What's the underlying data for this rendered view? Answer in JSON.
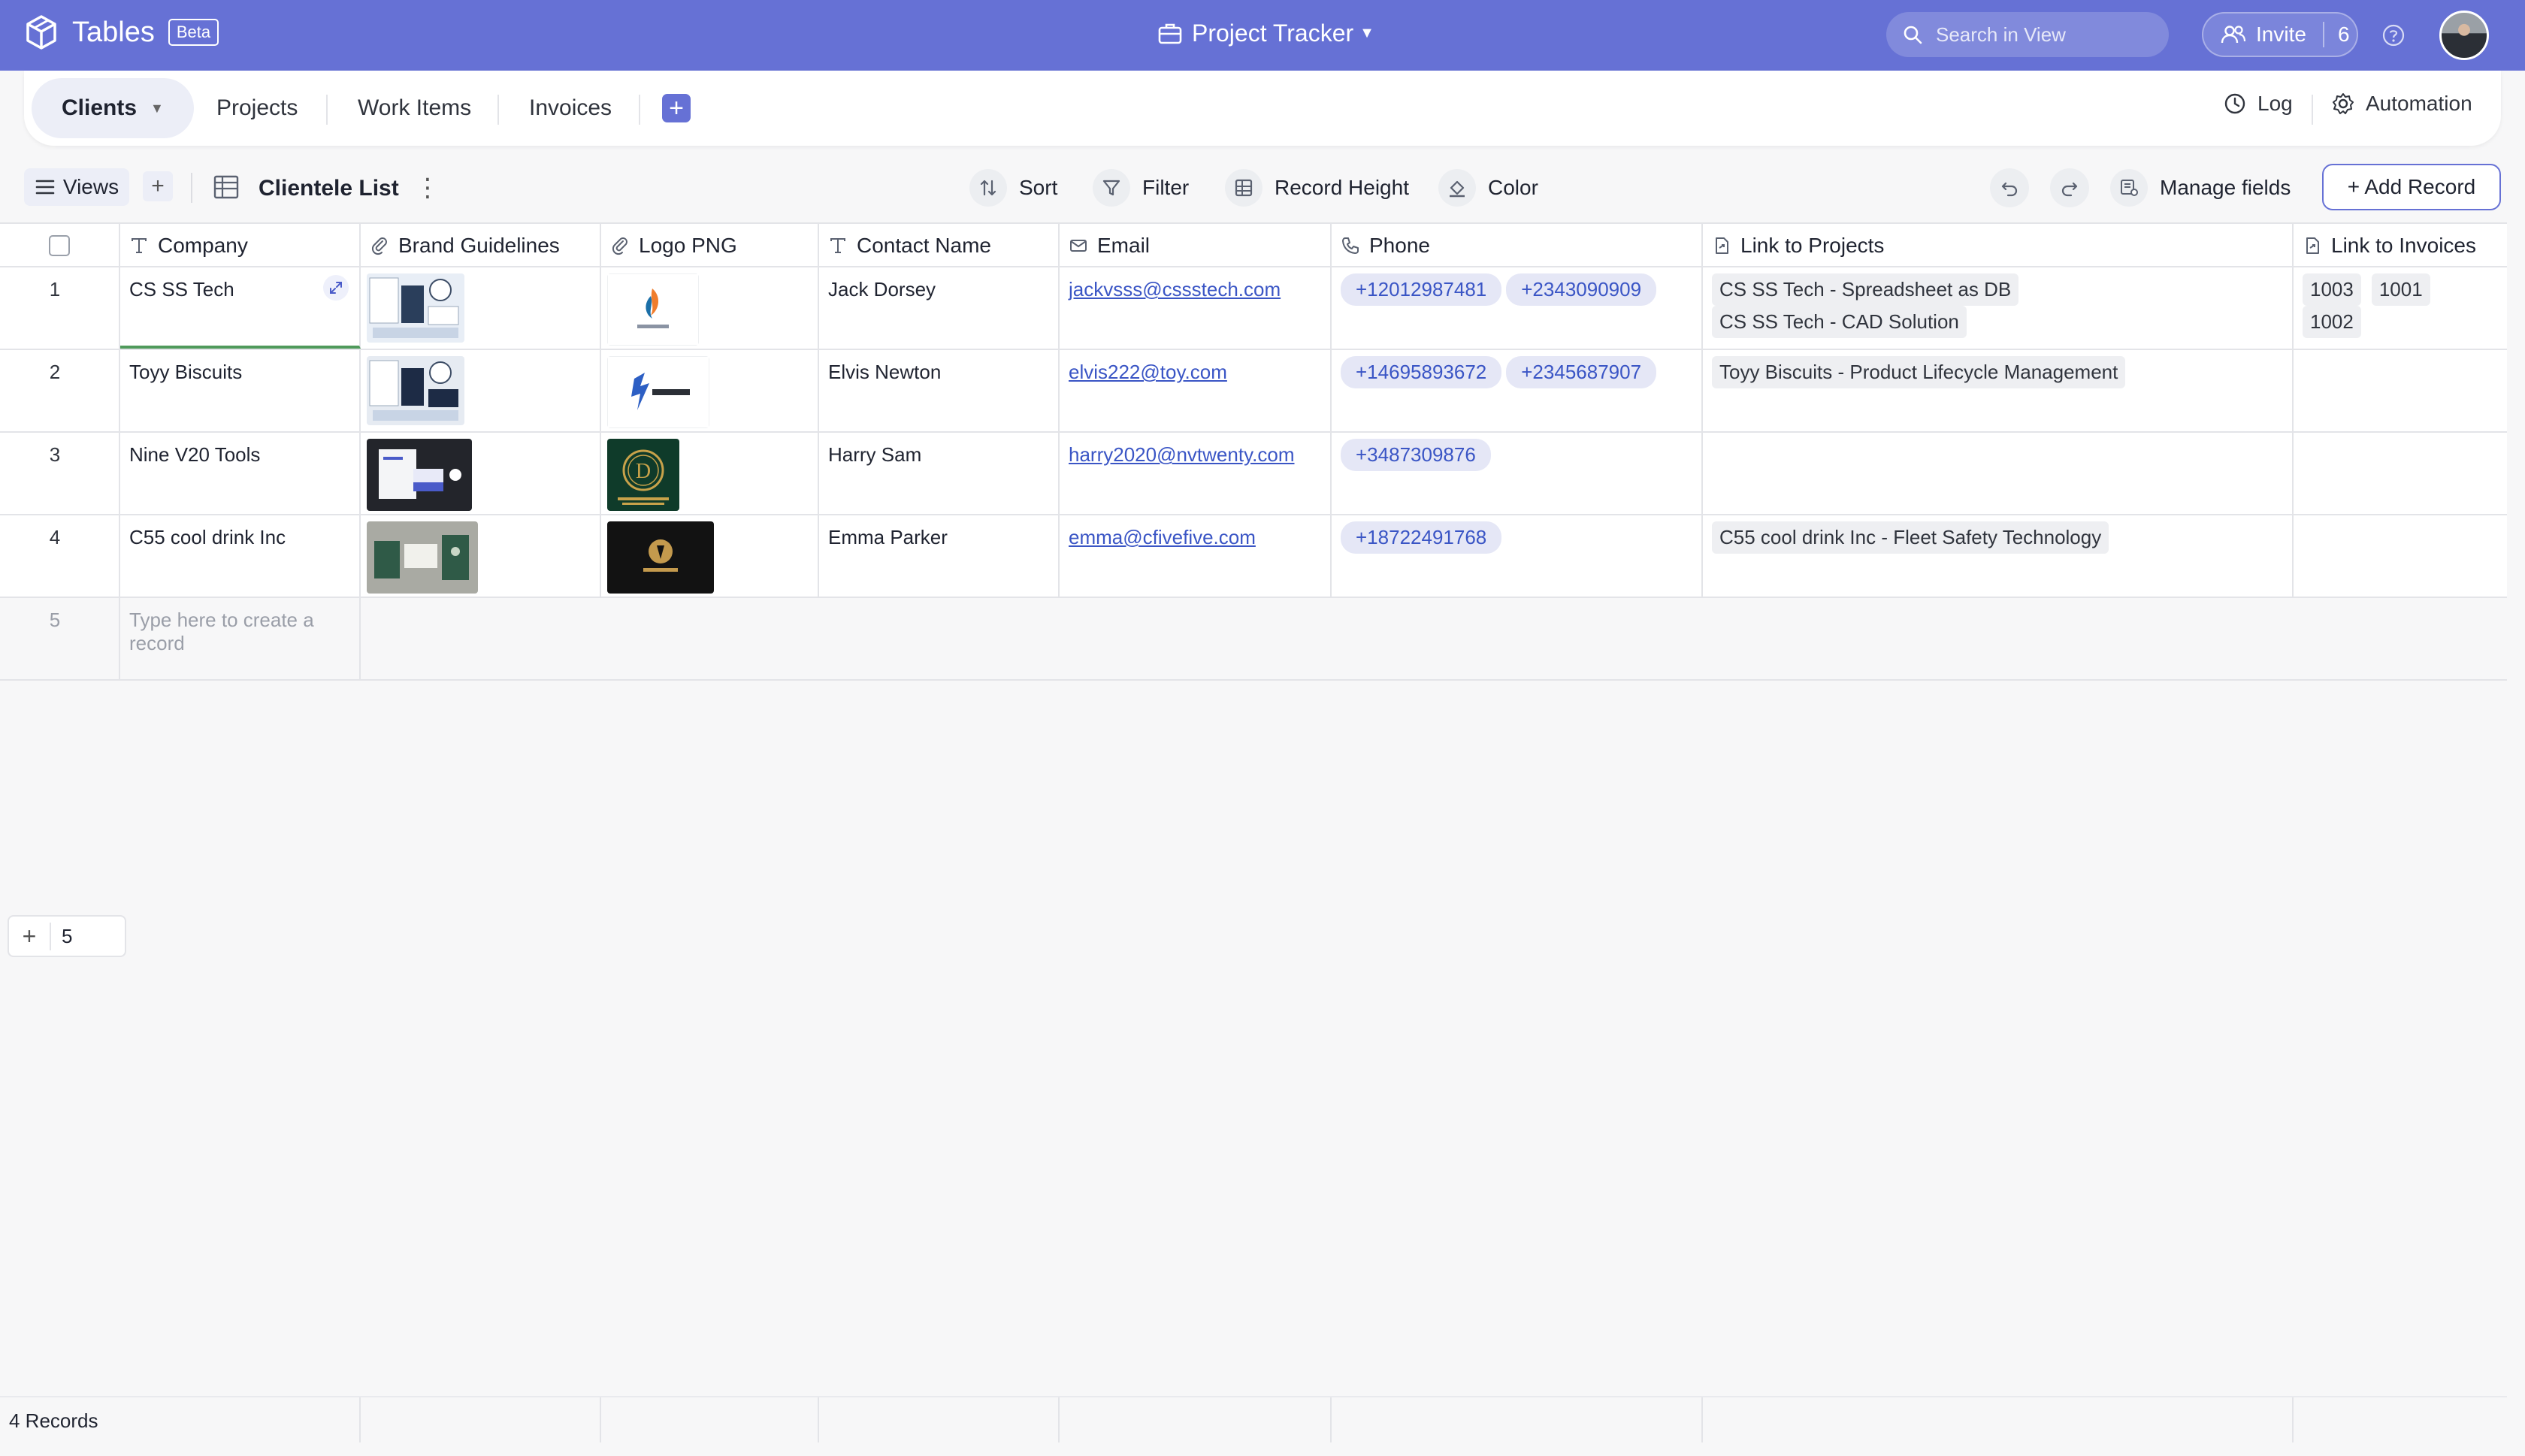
{
  "app": {
    "name": "Tables",
    "badge": "Beta"
  },
  "project": {
    "title": "Project Tracker"
  },
  "search": {
    "placeholder": "Search in View"
  },
  "invite": {
    "label": "Invite",
    "count": "6"
  },
  "tabs": [
    {
      "label": "Clients",
      "active": true
    },
    {
      "label": "Projects"
    },
    {
      "label": "Work Items"
    },
    {
      "label": "Invoices"
    }
  ],
  "tabs_right": {
    "log": "Log",
    "automation": "Automation"
  },
  "toolbar": {
    "views": "Views",
    "view_name": "Clientele List",
    "sort": "Sort",
    "filter": "Filter",
    "record_height": "Record Height",
    "color": "Color",
    "manage_fields": "Manage fields",
    "add_record": "+ Add Record"
  },
  "columns": [
    {
      "label": "Company",
      "icon": "text-field-icon"
    },
    {
      "label": "Brand Guidelines",
      "icon": "attachment-icon"
    },
    {
      "label": "Logo PNG",
      "icon": "attachment-icon"
    },
    {
      "label": "Contact Name",
      "icon": "text-field-icon"
    },
    {
      "label": "Email",
      "icon": "email-icon"
    },
    {
      "label": "Phone",
      "icon": "phone-icon"
    },
    {
      "label": "Link to Projects",
      "icon": "link-record-icon"
    },
    {
      "label": "Link to Invoices",
      "icon": "link-record-icon"
    }
  ],
  "rows": [
    {
      "num": "1",
      "company": "CS SS Tech",
      "contact": "Jack Dorsey",
      "email": "jackvsss@cssstech.com",
      "phones": [
        "+12012987481",
        "+2343090909"
      ],
      "projects": [
        "CS SS Tech - Spreadsheet as DB",
        "CS SS Tech - CAD Solution"
      ],
      "invoices": [
        "1003",
        "1001",
        "1002"
      ]
    },
    {
      "num": "2",
      "company": "Toyy Biscuits",
      "contact": "Elvis Newton",
      "email": "elvis222@toy.com",
      "phones": [
        "+14695893672",
        "+2345687907"
      ],
      "projects": [
        "Toyy Biscuits - Product Lifecycle Management"
      ],
      "invoices": []
    },
    {
      "num": "3",
      "company": "Nine V20 Tools",
      "contact": "Harry Sam",
      "email": "harry2020@nvtwenty.com",
      "phones": [
        "+3487309876"
      ],
      "projects": [],
      "invoices": []
    },
    {
      "num": "4",
      "company": "C55 cool drink Inc",
      "contact": "Emma Parker",
      "email": "emma@cfivefive.com",
      "phones": [
        "+18722491768"
      ],
      "projects": [
        "C55 cool drink Inc - Fleet Safety Technology"
      ],
      "invoices": []
    }
  ],
  "new_row": {
    "num": "5",
    "placeholder": "Type here to create a record"
  },
  "footer": {
    "add_count": "5",
    "records": "4 Records"
  }
}
